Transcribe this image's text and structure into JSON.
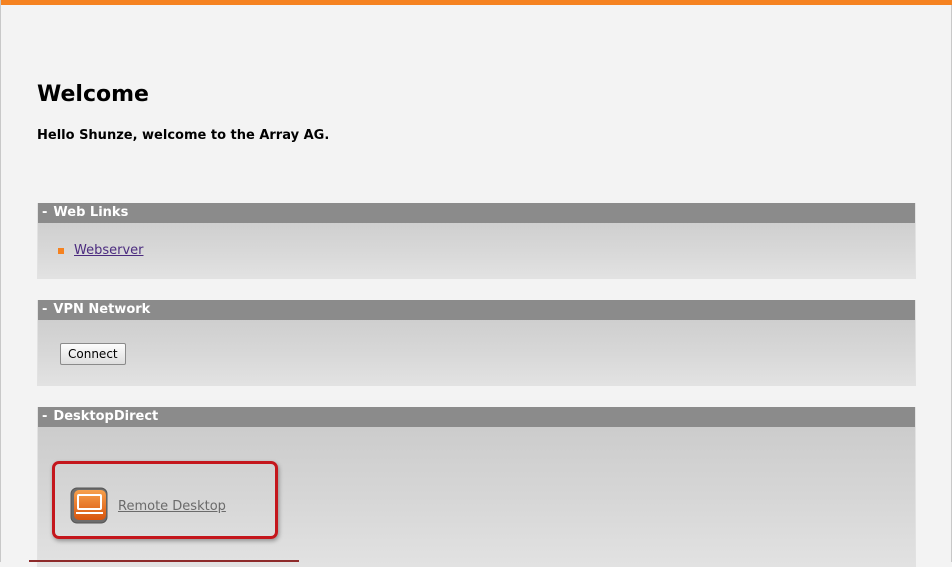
{
  "welcome": {
    "title": "Welcome",
    "message": "Hello Shunze, welcome to the Array AG."
  },
  "panels": {
    "web_links": {
      "toggle": "-",
      "title": "Web Links",
      "items": [
        {
          "label": "Webserver",
          "icon": "bullet-icon"
        }
      ]
    },
    "vpn": {
      "toggle": "-",
      "title": "VPN Network",
      "connect_label": "Connect"
    },
    "desktop_direct": {
      "toggle": "-",
      "title": "DesktopDirect",
      "items": [
        {
          "label": "Remote Desktop",
          "icon": "remote-desktop-icon"
        }
      ]
    }
  },
  "colors": {
    "accent": "#f58220",
    "panel_header": "#8b8b8b",
    "highlight": "#c4161c",
    "link": "#4b2b7f"
  }
}
